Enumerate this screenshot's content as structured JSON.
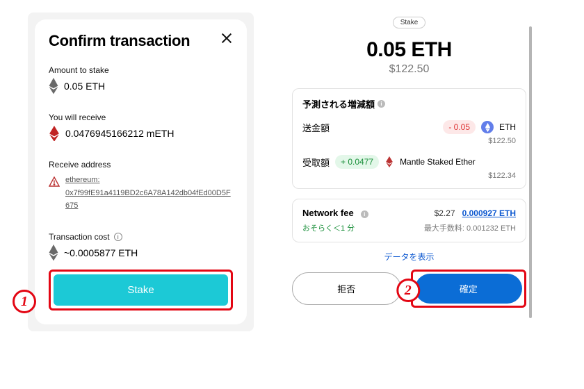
{
  "annotations": {
    "step1": "1",
    "step2": "2"
  },
  "left": {
    "title": "Confirm transaction",
    "amount_label": "Amount to stake",
    "amount_value": "0.05 ETH",
    "receive_label": "You will receive",
    "receive_value": "0.0476945166212 mETH",
    "address_label": "Receive address",
    "address_prefix": "ethereum:",
    "address_value": "0x7f99fE91a4119BD2c6A78A142db04fEd00D5F675",
    "cost_label": "Transaction cost",
    "cost_value": "~0.0005877 ETH",
    "stake_btn": "Stake"
  },
  "right": {
    "tag": "Stake",
    "main_amount": "0.05 ETH",
    "main_usd": "$122.50",
    "changes_title": "予測される増減額",
    "send_label": "送金額",
    "send_delta": "- 0.05",
    "send_asset": "ETH",
    "send_usd": "$122.50",
    "recv_label": "受取額",
    "recv_delta": "+ 0.0477",
    "recv_asset": "Mantle Staked Ether",
    "recv_usd": "$122.34",
    "fee_label": "Network fee",
    "fee_usd": "$2.27",
    "fee_eth": "0.000927 ETH",
    "fee_time": "おそらく＜1 分",
    "fee_max": "最大手数料: 0.001232 ETH",
    "show_data": "データを表示",
    "reject_btn": "拒否",
    "confirm_btn": "確定"
  }
}
